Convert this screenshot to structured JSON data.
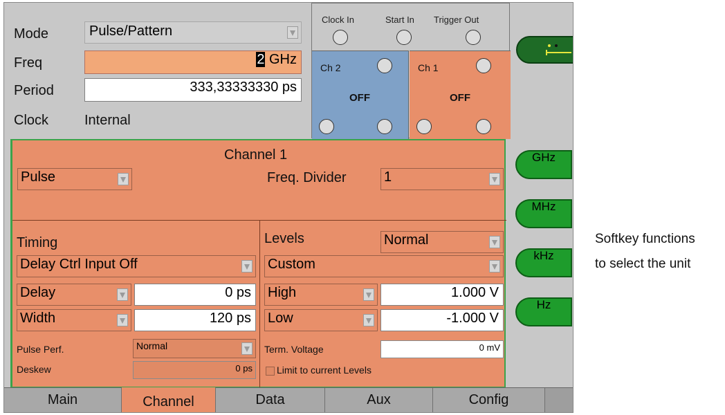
{
  "top": {
    "mode_label": "Mode",
    "mode_value": "Pulse/Pattern",
    "freq_label": "Freq",
    "freq_cursor_digit": "2",
    "freq_unit": "GHz",
    "period_label": "Period",
    "period_value": "333,33333330 ps",
    "clock_label": "Clock",
    "clock_value": "Internal"
  },
  "connectors": {
    "clock_in": "Clock In",
    "start_in": "Start In",
    "trigger_out": "Trigger Out",
    "ch2_label": "Ch 2",
    "ch2_state": "OFF",
    "ch1_label": "Ch 1",
    "ch1_state": "OFF"
  },
  "softkeys": [
    "GHz",
    "MHz",
    "kHz",
    "Hz"
  ],
  "channel": {
    "title": "Channel 1",
    "mode_value": "Pulse",
    "freq_divider_label": "Freq. Divider",
    "freq_divider_value": "1",
    "timing": {
      "heading": "Timing",
      "delay_ctrl": "Delay Ctrl Input Off",
      "delay_label": "Delay",
      "delay_value": "0 ps",
      "width_label": "Width",
      "width_value": "120 ps",
      "pulse_perf_label": "Pulse Perf.",
      "pulse_perf_value": "Normal",
      "deskew_label": "Deskew",
      "deskew_value": "0 ps"
    },
    "levels": {
      "heading": "Levels",
      "levels_mode": "Normal",
      "levels_type": "Custom",
      "high_label": "High",
      "high_value": "1.000 V",
      "low_label": "Low",
      "low_value": "-1.000 V",
      "term_voltage_label": "Term. Voltage",
      "term_voltage_value": "0 mV",
      "limit_label": "Limit to current Levels"
    }
  },
  "tabs": [
    {
      "label": "Main",
      "active": false
    },
    {
      "label": "Channel",
      "active": true
    },
    {
      "label": "Data",
      "active": false
    },
    {
      "label": "Aux",
      "active": false
    },
    {
      "label": "Config",
      "active": false
    }
  ],
  "annotation": {
    "line1": "Softkey functions",
    "line2": "to select the unit"
  },
  "colors": {
    "channel_bg": "#e88f6a",
    "ch2_bg": "#7fa1c7",
    "softkey_green": "#1e9c2c",
    "panel_border_green": "#3ca34a",
    "freq_field_bg": "#f2a878"
  }
}
